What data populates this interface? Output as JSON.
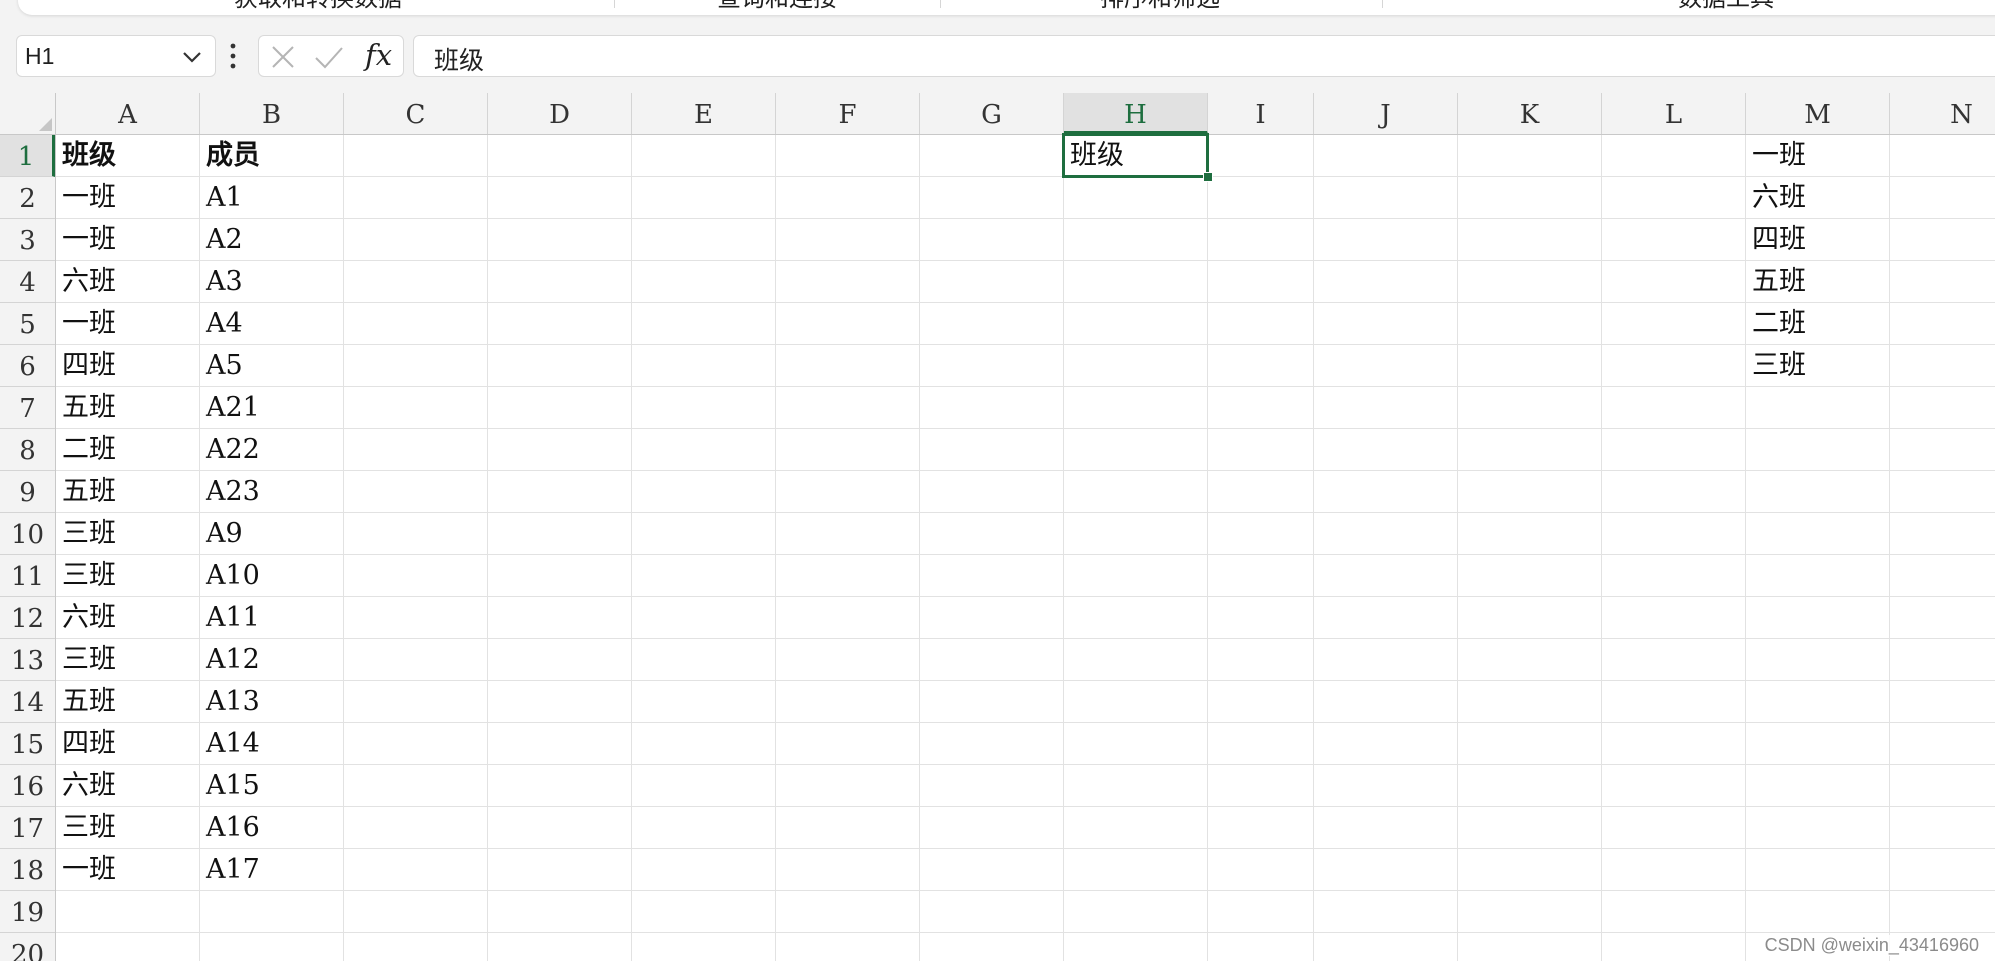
{
  "ribbon": {
    "groups": [
      {
        "label": "获取和转换数据",
        "center": 318
      },
      {
        "label": "查询和连接",
        "center": 777
      },
      {
        "label": "排序和筛选",
        "center": 1160
      },
      {
        "label": "数据工具",
        "center": 1726
      }
    ],
    "separators": [
      614,
      940,
      1382
    ]
  },
  "formula_bar": {
    "name_box": "H1",
    "formula": "班级",
    "fx_label": "fx"
  },
  "grid": {
    "columns": [
      "A",
      "B",
      "C",
      "D",
      "E",
      "F",
      "G",
      "H",
      "I",
      "J",
      "K",
      "L",
      "M",
      "N"
    ],
    "rows": [
      "1",
      "2",
      "3",
      "4",
      "5",
      "6",
      "7",
      "8",
      "9",
      "10",
      "11",
      "12",
      "13",
      "14",
      "15",
      "16",
      "17",
      "18",
      "19",
      "20"
    ],
    "active_column": "H",
    "active_row": "1",
    "cells": {
      "A1": "班级",
      "B1": "成员",
      "A2": "一班",
      "B2": "A1",
      "A3": "一班",
      "B3": "A2",
      "A4": "六班",
      "B4": "A3",
      "A5": "一班",
      "B5": "A4",
      "A6": "四班",
      "B6": "A5",
      "A7": "五班",
      "B7": "A21",
      "A8": "二班",
      "B8": "A22",
      "A9": "五班",
      "B9": "A23",
      "A10": "三班",
      "B10": "A9",
      "A11": "三班",
      "B11": "A10",
      "A12": "六班",
      "B12": "A11",
      "A13": "三班",
      "B13": "A12",
      "A14": "五班",
      "B14": "A13",
      "A15": "四班",
      "B15": "A14",
      "A16": "六班",
      "B16": "A15",
      "A17": "三班",
      "B17": "A16",
      "A18": "一班",
      "B18": "A17",
      "H1": "班级",
      "M1": "一班",
      "M2": "六班",
      "M3": "四班",
      "M4": "五班",
      "M5": "二班",
      "M6": "三班"
    },
    "bold_cells": [
      "A1",
      "B1"
    ]
  },
  "watermark": "CSDN @weixin_43416960"
}
